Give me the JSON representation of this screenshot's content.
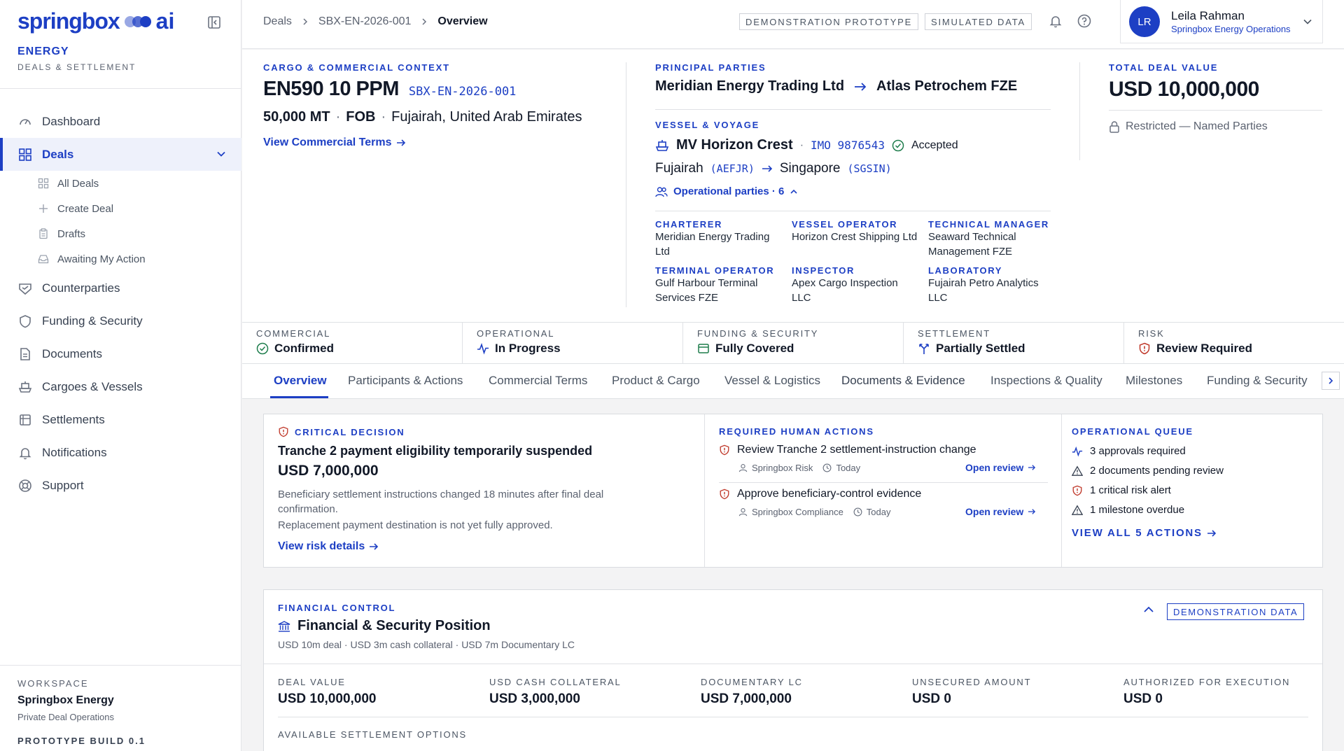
{
  "brand": {
    "logo": "springbox",
    "logo_ai": "ai",
    "section": "ENERGY",
    "subtitle": "DEALS & SETTLEMENT"
  },
  "sidebar": {
    "items": [
      {
        "label": "Dashboard",
        "icon": "dashboard-icon"
      },
      {
        "label": "Deals",
        "icon": "grid-icon",
        "active": true
      },
      {
        "label": "Counterparties",
        "icon": "handshake-icon"
      },
      {
        "label": "Funding & Security",
        "icon": "shield-icon"
      },
      {
        "label": "Documents",
        "icon": "document-icon"
      },
      {
        "label": "Cargoes & Vessels",
        "icon": "ship-icon"
      },
      {
        "label": "Settlements",
        "icon": "ledger-icon"
      },
      {
        "label": "Notifications",
        "icon": "bell-icon"
      },
      {
        "label": "Support",
        "icon": "lifebuoy-icon"
      }
    ],
    "deal_sub": [
      {
        "label": "All Deals",
        "icon": "grid-small-icon"
      },
      {
        "label": "Create Deal",
        "icon": "plus-icon"
      },
      {
        "label": "Drafts",
        "icon": "clipboard-icon"
      },
      {
        "label": "Awaiting My Action",
        "icon": "inbox-icon"
      }
    ],
    "workspace": {
      "label": "WORKSPACE",
      "name": "Springbox Energy",
      "desc": "Private Deal Operations",
      "build": "PROTOTYPE BUILD 0.1"
    }
  },
  "topbar": {
    "breadcrumbs": [
      "Deals",
      "SBX-EN-2026-001",
      "Overview"
    ],
    "tags": [
      "DEMONSTRATION PROTOTYPE",
      "SIMULATED DATA"
    ],
    "user": {
      "initials": "LR",
      "name": "Leila Rahman",
      "org": "Springbox Energy Operations"
    }
  },
  "cargo": {
    "label": "CARGO & COMMERCIAL CONTEXT",
    "product": "EN590 10 PPM",
    "deal_id": "SBX-EN-2026-001",
    "quantity": "50,000 MT",
    "incoterm": "FOB",
    "location": "Fujairah, United Arab Emirates",
    "link": "View Commercial Terms"
  },
  "parties": {
    "label": "PRINCIPAL PARTIES",
    "seller": "Meridian Energy Trading Ltd",
    "buyer": "Atlas Petrochem FZE"
  },
  "vessel": {
    "label": "VESSEL & VOYAGE",
    "name": "MV Horizon Crest",
    "imo": "IMO 9876543",
    "status": "Accepted",
    "from": "Fujairah",
    "from_code": "(AEFJR)",
    "to": "Singapore",
    "to_code": "(SGSIN)",
    "op_parties": "Operational parties · 6"
  },
  "operational": [
    {
      "role": "CHARTERER",
      "name": "Meridian Energy Trading Ltd"
    },
    {
      "role": "VESSEL OPERATOR",
      "name": "Horizon Crest Shipping Ltd"
    },
    {
      "role": "TECHNICAL MANAGER",
      "name": "Seaward Technical Management FZE"
    },
    {
      "role": "TERMINAL OPERATOR",
      "name": "Gulf Harbour Terminal Services FZE"
    },
    {
      "role": "INSPECTOR",
      "name": "Apex Cargo Inspection LLC"
    },
    {
      "role": "LABORATORY",
      "name": "Fujairah Petro Analytics LLC"
    }
  ],
  "deal_value": {
    "label": "TOTAL DEAL VALUE",
    "value": "USD 10,000,000",
    "restriction": "Restricted — Named Parties"
  },
  "status": [
    {
      "label": "COMMERCIAL",
      "value": "Confirmed",
      "icon": "check-circle-icon",
      "color": "#1e7d4c"
    },
    {
      "label": "OPERATIONAL",
      "value": "In Progress",
      "icon": "activity-icon",
      "color": "#1d3fc4"
    },
    {
      "label": "FUNDING & SECURITY",
      "value": "Fully Covered",
      "icon": "wallet-icon",
      "color": "#1e7d4c"
    },
    {
      "label": "SETTLEMENT",
      "value": "Partially Settled",
      "icon": "split-icon",
      "color": "#1d3fc4"
    },
    {
      "label": "RISK",
      "value": "Review Required",
      "icon": "shield-alert-icon",
      "color": "#c0392b"
    }
  ],
  "tabs": [
    "Overview",
    "Participants & Actions",
    "Commercial Terms",
    "Product & Cargo",
    "Vessel & Logistics",
    "Documents & Evidence",
    "Inspections & Quality",
    "Milestones",
    "Funding & Security"
  ],
  "critical": {
    "label": "CRITICAL DECISION",
    "title": "Tranche 2 payment eligibility temporarily suspended",
    "amount": "USD 7,000,000",
    "desc1": "Beneficiary settlement instructions changed 18 minutes after final deal confirmation.",
    "desc2": "Replacement payment destination is not yet fully approved.",
    "link": "View risk details"
  },
  "human_actions": {
    "label": "REQUIRED HUMAN ACTIONS",
    "items": [
      {
        "title": "Review Tranche 2 settlement-instruction change",
        "owner": "Springbox Risk",
        "when": "Today",
        "link": "Open review"
      },
      {
        "title": "Approve beneficiary-control evidence",
        "owner": "Springbox Compliance",
        "when": "Today",
        "link": "Open review"
      }
    ]
  },
  "queue": {
    "label": "OPERATIONAL QUEUE",
    "items": [
      {
        "text": "3 approvals required",
        "icon": "activity-icon"
      },
      {
        "text": "2 documents pending review",
        "icon": "warning-icon"
      },
      {
        "text": "1 critical risk alert",
        "icon": "shield-alert-icon"
      },
      {
        "text": "1 milestone overdue",
        "icon": "warning-icon"
      }
    ],
    "link": "VIEW ALL 5 ACTIONS"
  },
  "financial": {
    "label": "FINANCIAL CONTROL",
    "title": "Financial & Security Position",
    "summary": "USD 10m deal · USD 3m cash collateral · USD 7m Documentary LC",
    "badge": "DEMONSTRATION DATA",
    "metrics": [
      {
        "label": "DEAL VALUE",
        "value": "USD 10,000,000"
      },
      {
        "label": "USD CASH COLLATERAL",
        "value": "USD 3,000,000"
      },
      {
        "label": "DOCUMENTARY LC",
        "value": "USD 7,000,000"
      },
      {
        "label": "UNSECURED AMOUNT",
        "value": "USD 0"
      },
      {
        "label": "AUTHORIZED FOR EXECUTION",
        "value": "USD 0"
      }
    ],
    "options_label": "AVAILABLE SETTLEMENT OPTIONS"
  },
  "colors": {
    "accent": "#1d3fc4",
    "success": "#1e7d4c",
    "danger": "#c0392b"
  }
}
